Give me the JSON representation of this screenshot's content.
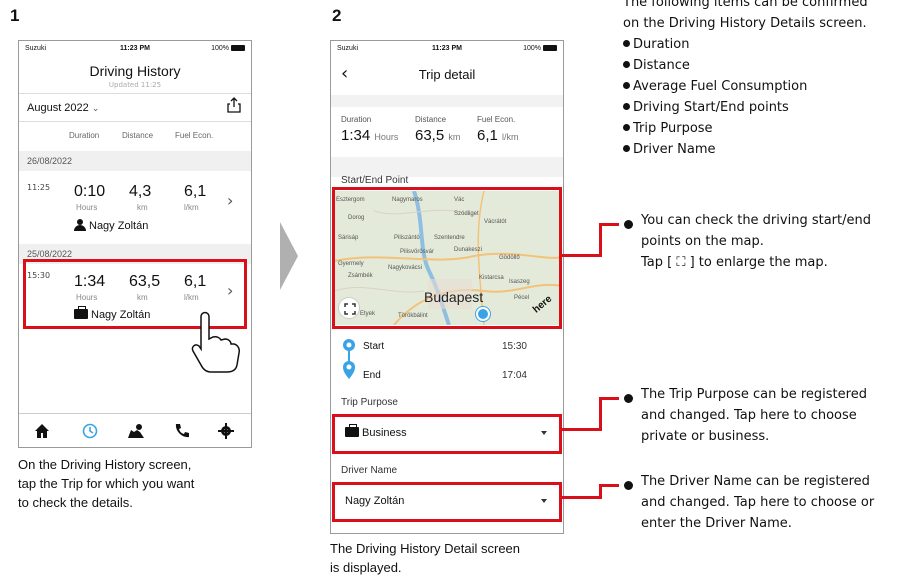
{
  "step1": {
    "number": "1",
    "status": {
      "carrier": "Suzuki",
      "time": "11:23 PM",
      "battery": "100%"
    },
    "title": "Driving History",
    "updated": "Updated 11:25",
    "month": "August 2022",
    "columns": {
      "duration": "Duration",
      "distance": "Distance",
      "fuel": "Fuel Econ."
    },
    "groups": [
      {
        "date": "26/08/2022",
        "time": "11:25",
        "duration": "0:10",
        "distance": "4,3",
        "fuel": "6,1",
        "duration_unit": "Hours",
        "distance_unit": "km",
        "fuel_unit": "l/km",
        "driver": "Nagy Zoltán"
      },
      {
        "date": "25/08/2022",
        "time": "15:30",
        "duration": "1:34",
        "distance": "63,5",
        "fuel": "6,1",
        "duration_unit": "Hours",
        "distance_unit": "km",
        "fuel_unit": "l/km",
        "driver": "Nagy Zoltán"
      }
    ],
    "caption": [
      "On the Driving History screen,",
      "tap the Trip for which you want",
      "to check the details."
    ]
  },
  "step2": {
    "number": "2",
    "status": {
      "carrier": "Suzuki",
      "time": "11:23 PM",
      "battery": "100%"
    },
    "back": "‹",
    "title": "Trip detail",
    "labels": {
      "duration": "Duration",
      "distance": "Distance",
      "fuel": "Fuel Econ."
    },
    "duration": "1:34",
    "duration_unit": "Hours",
    "distance": "63,5",
    "distance_unit": "km",
    "fuel": "6,1",
    "fuel_unit": "l/km",
    "start_end_label": "Start/End Point",
    "map_labels": {
      "city": "Budapest",
      "l1": "Szentendre",
      "l2": "Dunakeszi",
      "l3": "Gödöllő",
      "l4": "Pilisvörösvár",
      "l5": "Nagykovácsi",
      "l6": "Kistarcsa",
      "l7": "Isaszeg",
      "l8": "Pécel",
      "l9": "Törökbálint",
      "l10": "Etyek",
      "l11": "Gyermely",
      "l12": "Zsámbék",
      "l13": "Dorog",
      "l14": "Sárisáp",
      "l15": "Szódliget",
      "l16": "Vácrátót",
      "l17": "Vác",
      "l18": "Nagymaros",
      "l19": "Esztergom",
      "l20": "Piliszántó",
      "l21": "Gödöllő",
      "brand": "here"
    },
    "start_label": "Start",
    "start_time": "15:30",
    "end_label": "End",
    "end_time": "17:04",
    "trip_purpose_label": "Trip Purpose",
    "trip_purpose_value": "Business",
    "driver_name_label": "Driver Name",
    "driver_name_value": "Nagy Zoltán",
    "caption": [
      "The Driving History Detail screen",
      "is displayed."
    ]
  },
  "info": {
    "intro": [
      "The following items can be confirmed",
      "on the Driving History Details screen."
    ],
    "items": [
      "Duration",
      "Distance",
      "Average Fuel Consumption",
      "Driving Start/End points",
      "Trip Purpose",
      "Driver Name"
    ]
  },
  "callouts": {
    "map": [
      "You can check the driving start/end",
      "points on the map.",
      "Tap [ ⛶ ] to enlarge the map."
    ],
    "purpose": [
      "The Trip Purpose can be registered",
      "and changed. Tap here to choose",
      "private or business."
    ],
    "driver": [
      "The Driver Name can be registered",
      "and changed. Tap here to choose or",
      "enter the Driver Name."
    ]
  },
  "colors": {
    "highlight": "#d9101a",
    "accent": "#3aa3e6"
  }
}
